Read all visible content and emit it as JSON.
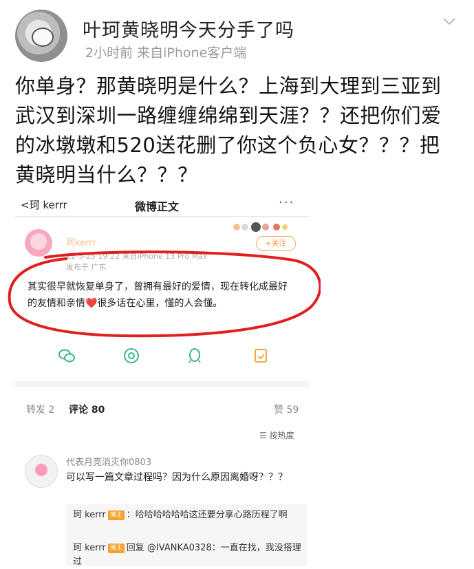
{
  "post": {
    "title": "叶珂黄晓明今天分手了吗",
    "meta": "2小时前  来自iPhone客户端",
    "text": "你单身？那黄晓明是什么？上海到大理到三亚到武汉到深圳一路缠缠绵绵到天涯？？还把你们爱的冰墩墩和520送花删了你这个负心女？？？把黄晓明当什么？？？"
  },
  "embed": {
    "back_label": "珂 kerrr",
    "nav_title": "微博正文",
    "more": "···",
    "author": "珂kerrr",
    "follow_label": "+关注",
    "meta": "22-5-25 19:22  来自iPhone 13 Pro Max",
    "location": "发布于 广东",
    "text": "其实很早就恢复单身了，曾拥有最好的爱情，现在转化成最好的友情和亲情❤️很多话在心里，懂的人会懂。",
    "tabs": {
      "repost": "转发 2",
      "comment": "评论 80",
      "like": "赞 59"
    },
    "sort_label": "按热度",
    "comment": {
      "user": "代表月亮消灭你0803",
      "text": "可以写一篇文章过程吗？因为什么原因离婚呀？？？",
      "replies": [
        {
          "name": "珂 kerrr",
          "badge": "博主",
          "text": "：哈哈哈哈哈哈这还要分享心路历程了啊"
        },
        {
          "name": "珂 kerrr",
          "badge": "博主",
          "text": "回复 @IVANKA0328：一直在找，我没搭理过"
        }
      ]
    }
  },
  "colors": {
    "accent_orange": "#f08a2c",
    "circle_red": "#e02020",
    "icon_green": "#3bb48a"
  }
}
